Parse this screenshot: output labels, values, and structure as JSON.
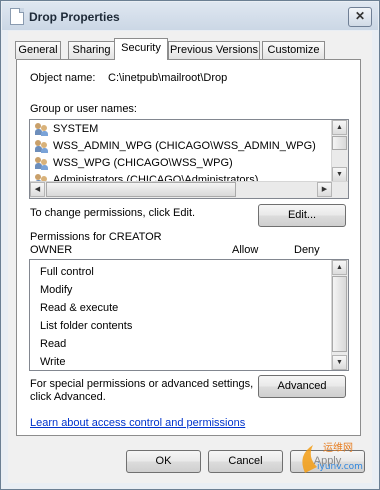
{
  "window": {
    "title": "Drop Properties",
    "close_glyph": "✕"
  },
  "tabs": [
    "General",
    "Sharing",
    "Security",
    "Previous Versions",
    "Customize"
  ],
  "active_tab": "Security",
  "object": {
    "label": "Object name:",
    "value": "C:\\inetpub\\mailroot\\Drop"
  },
  "groups": {
    "label": "Group or user names:",
    "items": [
      "SYSTEM",
      "WSS_ADMIN_WPG (CHICAGO\\WSS_ADMIN_WPG)",
      "WSS_WPG (CHICAGO\\WSS_WPG)",
      "Administrators (CHICAGO\\Administrators)"
    ],
    "selected_index": 0
  },
  "change_text": "To change permissions, click Edit.",
  "edit_button": "Edit...",
  "permissions": {
    "label_line1": "Permissions for CREATOR",
    "label_line2": "OWNER",
    "allow": "Allow",
    "deny": "Deny",
    "items": [
      "Full control",
      "Modify",
      "Read & execute",
      "List folder contents",
      "Read",
      "Write"
    ]
  },
  "special": {
    "line1": "For special permissions or advanced settings,",
    "line2": "click Advanced.",
    "button": "Advanced"
  },
  "learn_link": "Learn about access control and permissions",
  "buttons": {
    "ok": "OK",
    "cancel": "Cancel",
    "apply": "Apply"
  },
  "watermark": {
    "line1": "运维网",
    "line2": "iyunv.com"
  }
}
